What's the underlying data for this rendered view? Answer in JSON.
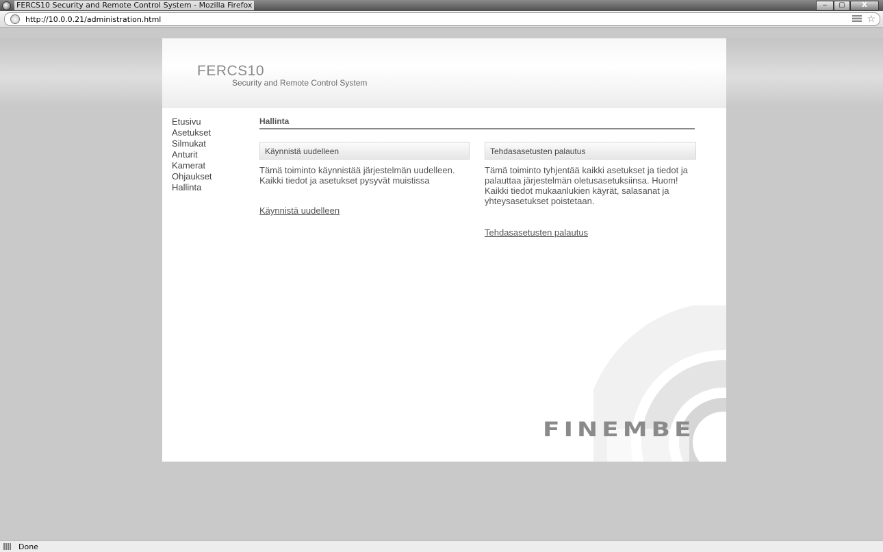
{
  "window": {
    "title": "FERCS10 Security and Remote Control System - Mozilla Firefox",
    "min_symbol": "‒",
    "max_symbol": "▢",
    "close_symbol": "X"
  },
  "address_bar": {
    "url": "http://10.0.0.21/administration.html",
    "star_symbol": "☆"
  },
  "header": {
    "logo": "FERCS10",
    "subtitle": "Security and Remote Control System"
  },
  "sidebar": {
    "items": [
      {
        "label": "Etusivu"
      },
      {
        "label": "Asetukset"
      },
      {
        "label": "Silmukat"
      },
      {
        "label": "Anturit"
      },
      {
        "label": "Kamerat"
      },
      {
        "label": "Ohjaukset"
      },
      {
        "label": "Hallinta"
      }
    ]
  },
  "main": {
    "title": "Hallinta",
    "restart": {
      "heading": "Käynnistä uudelleen",
      "description": "Tämä toiminto käynnistää järjestelmän uudelleen. Kaikki tiedot ja asetukset pysyvät muistissa",
      "link": "Käynnistä uudelleen"
    },
    "factory_reset": {
      "heading": "Tehdasasetusten palautus",
      "description": "Tämä toiminto tyhjentää kaikki asetukset ja tiedot ja palauttaa järjestelmän oletusasetuksiinsa. Huom! Kaikki tiedot mukaanlukien käyrät, salasanat ja yhteysasetukset poistetaan.",
      "link": "Tehdasasetusten palautus"
    }
  },
  "brand": {
    "logo_text": "FINEMBE"
  },
  "status_bar": {
    "text": "Done"
  }
}
